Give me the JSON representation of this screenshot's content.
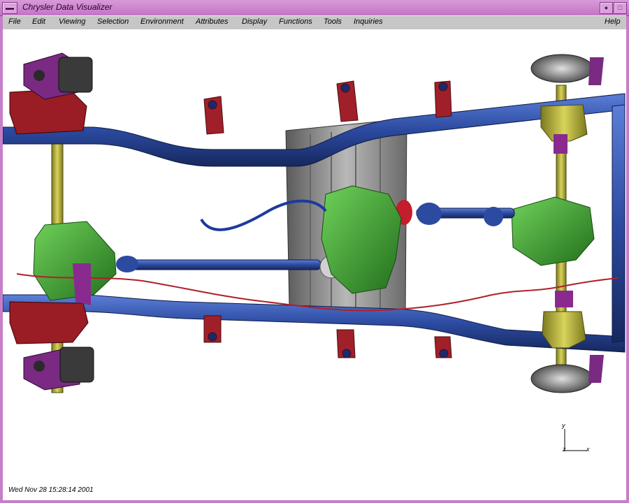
{
  "window": {
    "title": "Chrysler Data Visualizer"
  },
  "menubar": {
    "items": [
      "File",
      "Edit",
      "Viewing",
      "Selection",
      "Environment",
      "Attributes",
      "Display",
      "Functions",
      "Tools",
      "Inquiries"
    ],
    "help": "Help"
  },
  "viewport": {
    "timestamp": "Wed Nov 28 15:28:14 2001",
    "axis": {
      "y": "y",
      "z": "z",
      "x": "x"
    }
  },
  "colors": {
    "frame_blue": "#2c4aa0",
    "transfer_green": "#3a9a2a",
    "axle_yellow": "#b9b43a",
    "bracket_red": "#a0202a",
    "accent_purple": "#8a2a8e",
    "skid_gray": "#8c8c8c"
  }
}
